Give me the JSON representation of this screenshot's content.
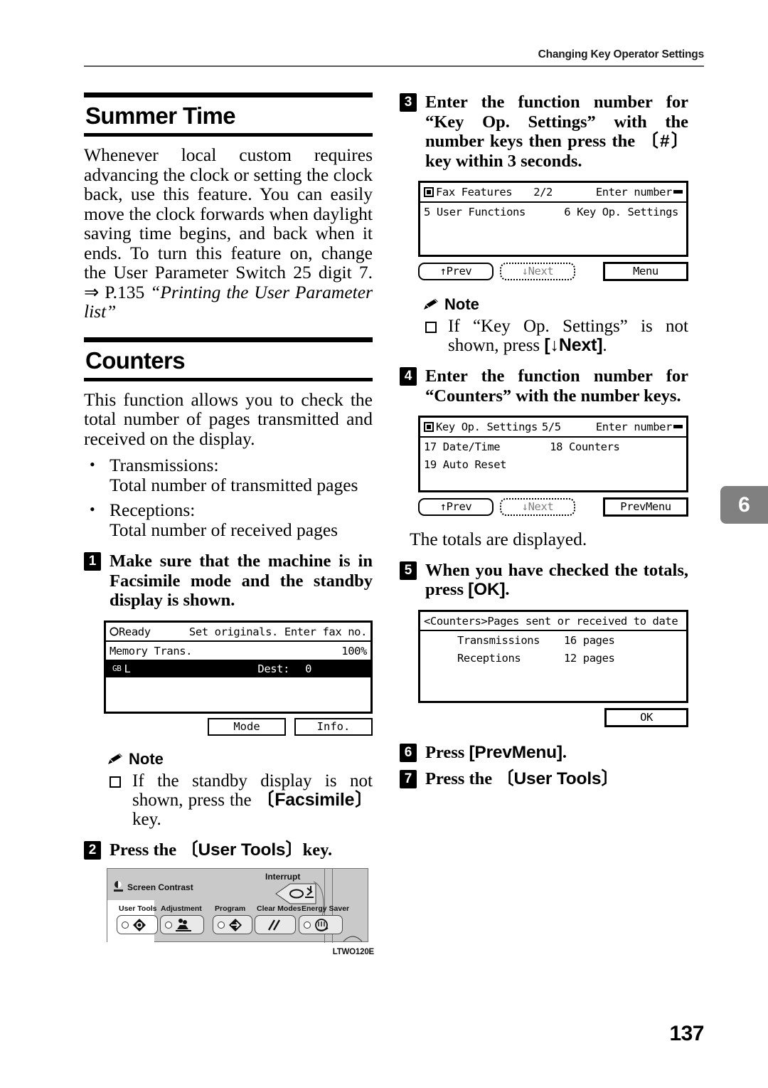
{
  "header": {
    "running_head": "Changing Key Operator Settings"
  },
  "side_tab": {
    "chapter": "6"
  },
  "folio": {
    "page_number": "137"
  },
  "left_column": {
    "section1": {
      "title": "Summer Time",
      "paragraph_plain": "Whenever local custom requires advancing the clock or setting the clock back, use this feature. You can easily move the clock forwards when daylight saving time begins, and back when it ends. To turn this feature on, change the User Parameter Switch 25 digit 7. ⇒ P.135 ",
      "paragraph_italic": "“Printing the User Parameter list”"
    },
    "section2": {
      "title": "Counters",
      "intro": "This function allows you to check the total number of pages transmitted and received on the display.",
      "bullets": [
        {
          "label": "Transmissions:",
          "detail": "Total number of transmitted pages"
        },
        {
          "label": "Receptions:",
          "detail": "Total number of received pages"
        }
      ]
    },
    "step1": {
      "number": "1",
      "text": "Make sure that the machine is in Facsimile mode and the standby display is shown."
    },
    "lcd_standby": {
      "status_icon": "circle-indicator",
      "status": "Ready",
      "prompt": "Set originals. Enter fax no.",
      "row2_label": "Memory Trans.",
      "row2_value": "100%",
      "row3_icon": "GB",
      "row3_left": "L",
      "row3_label": "Dest:",
      "row3_value": "0",
      "buttons": [
        "Mode",
        "Info."
      ]
    },
    "note1": {
      "heading": "Note",
      "item_before": "If the standby display is not shown, press the ",
      "item_key": "〔Facsimile〕",
      "item_after": " key."
    },
    "step2": {
      "number": "2",
      "text_before": "Press the ",
      "key": "〔User Tools〕",
      "text_after": "key."
    },
    "panel_art": {
      "screen_contrast_label": "Screen Contrast",
      "interrupt_label": "Interrupt",
      "keys": [
        {
          "label": "User Tools",
          "icon": "user-tools-icon"
        },
        {
          "label": "Adjustment",
          "icon": "adjustment-icon"
        },
        {
          "label": "Program",
          "icon": "program-icon"
        },
        {
          "label": "Clear Modes",
          "icon": "clear-modes-icon"
        },
        {
          "label": "Energy Saver",
          "icon": "energy-saver-icon"
        }
      ],
      "art_code": "LTWO120E"
    }
  },
  "right_column": {
    "step3": {
      "number": "3",
      "text_a": "Enter the function number for “Key Op. Settings” with the number keys then press the ",
      "key": "〔#〕",
      "text_b": " key within 3 seconds."
    },
    "lcd_fax_features": {
      "icon": "filled-square-icon",
      "title": "Fax Features",
      "page": "2/2",
      "prompt": "Enter number",
      "cursor": "input-cursor",
      "items": [
        "5 User Functions",
        "6 Key Op. Settings"
      ],
      "softkeys": {
        "prev": "↑Prev",
        "next": "↓Next",
        "right": "Menu"
      }
    },
    "note2": {
      "heading": "Note",
      "item_before": "If “Key Op. Settings” is not shown, press ",
      "item_key": "[↓Next]",
      "item_after": "."
    },
    "step4": {
      "number": "4",
      "text": "Enter the function number for “Counters” with the number keys."
    },
    "lcd_key_op": {
      "icon": "filled-square-icon",
      "title": "Key Op. Settings",
      "page": "5/5",
      "prompt": "Enter number",
      "cursor": "input-cursor",
      "items_row1": [
        "17 Date/Time",
        "18 Counters"
      ],
      "items_row2": [
        "19 Auto Reset"
      ],
      "softkeys": {
        "prev": "↑Prev",
        "next": "↓Next",
        "right": "PrevMenu"
      }
    },
    "after_lcd_text": "The totals are displayed.",
    "step5": {
      "number": "5",
      "text_before": "When you have checked the totals, press ",
      "key": "[OK]",
      "text_after": "."
    },
    "lcd_counters": {
      "title_tag": "<Counters>",
      "title_text": "Pages sent or received to date",
      "rows": [
        {
          "label": "Transmissions",
          "value": "16 pages"
        },
        {
          "label": "Receptions",
          "value": "12 pages"
        }
      ],
      "ok_button": "OK"
    },
    "step6": {
      "number": "6",
      "text_before": "Press ",
      "key": "[PrevMenu]",
      "text_after": "."
    },
    "step7": {
      "number": "7",
      "text_before": "Press the ",
      "key": "〔User Tools〕",
      "text_after": ""
    }
  }
}
